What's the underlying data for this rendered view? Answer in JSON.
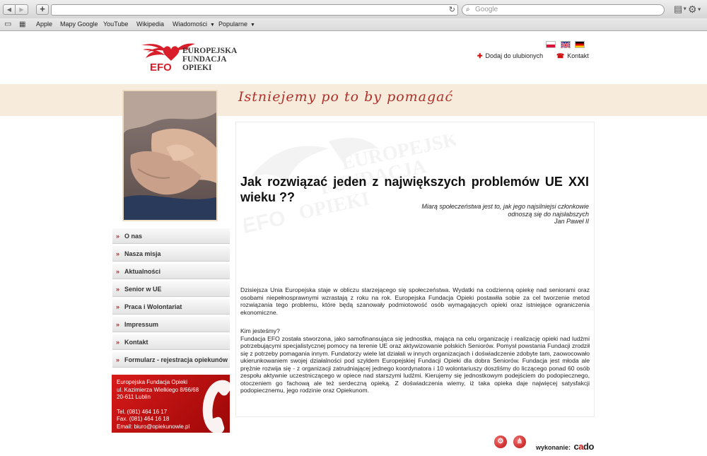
{
  "browser": {
    "search_placeholder": "Google",
    "bookmarks": [
      "Apple",
      "Mapy Google",
      "YouTube",
      "Wikipedia",
      "Wiadomości",
      "Popularne"
    ]
  },
  "site": {
    "logo": {
      "line1": "EUROPEJSKA",
      "line2": "FUNDACJA",
      "line3": "OPIEKI",
      "abbr": "EFO"
    },
    "toplinks": {
      "favorites": "Dodaj do ulubionych",
      "contact": "Kontakt"
    },
    "slogan": "Istniejemy po to by pomagać",
    "menu": [
      "O nas",
      "Nasza misja",
      "Aktualności",
      "Senior w UE",
      "Praca i Wolontariat",
      "Impressum",
      "Kontakt",
      "Formularz - rejestracja opiekunów"
    ],
    "contact_box": {
      "org": "Europejska Fundacja Opieki",
      "street": "ul. Kazimierza Wielkiego 8/66/68",
      "city": "20-611 Lublin",
      "tel": "Tel. (081) 464 16 17",
      "fax": "Fax. (081) 464 16 18",
      "email": "Email: biuro@opiekunowie.pl"
    },
    "article": {
      "headline": "Jak rozwiązać jeden z największych problemów UE XXI wieku ??",
      "quote_line1": "Miarą społeczeństwa jest to, jak jego najsilniejsi członkowie",
      "quote_line2": "odnoszą się do najsłabszych",
      "quote_author": "Jan Paweł II",
      "p1": "Dzisiejsza Unia Europejska staje w obliczu starzejącego się społeczeństwa. Wydatki na codzienną opiekę nad seniorami oraz osobami niepełnosprawnymi wzrastają z roku na rok. Europejska Fundacja Opieki postawiła sobie za cel tworzenie metod rozwiązania tego problemu, które będą szanowały podmiotowość osób wymagających opieki oraz istniejące ograniczenia ekonomiczne.",
      "p2_title": "Kim jesteśmy?",
      "p2": "Fundacja EFO została stworzona, jako samofinansująca się jednostka, mająca na celu organizację i realizację opieki nad ludźmi potrzebującymi specjalistycznej pomocy na terenie UE oraz aktywizowanie polskich Seniorów. Pomysł powstania Fundacji zrodził się z potrzeby pomagania innym. Fundatorzy wiele lat działali w innych organizacjach i doświadczenie zdobyte tam, zaowocowało ukierunkowaniem swojej działalności pod szyldem Europejskiej Fundacji Opieki dla dobra Seniorów. Fundacja jest młoda ale prężnie rozwija się - z organizacji zatrudniającej jednego koordynatora i 10 wolontariuszy doszliśmy do liczącego ponad 60 osób zespołu aktywnie uczestniczącego w opiece nad starszymi ludźmi. Kierujemy się jednostkowym podejściem do podopiecznego, otoczeniem go fachową ale też serdeczną opieką. Z doświadczenia wiemy, iż taka opieka daje najwięcej satysfakcji podopiecznemu, jego rodzinie oraz Opiekunom."
    },
    "footer": {
      "credit_label": "wykonanie:",
      "brand_prefix": "c",
      "brand_o": "a",
      "brand_suffix": "do"
    }
  },
  "colors": {
    "accent": "#c81414",
    "banner": "#f7ecdc",
    "slogan": "#b0302a"
  }
}
